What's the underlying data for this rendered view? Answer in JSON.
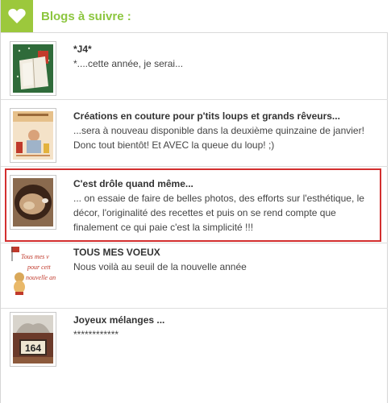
{
  "header": {
    "title": "Blogs à suivre :",
    "icon": "heart-icon",
    "accent": "#9cc83c"
  },
  "posts": [
    {
      "title": "*J4*",
      "excerpt": "*....cette année, je serai..."
    },
    {
      "title": "Créations en couture pour p'tits loups et grands rêveurs...",
      "excerpt": "...sera à nouveau disponible dans la deuxième quinzaine de janvier! Donc tout bientôt! Et AVEC la queue du loup! ;)"
    },
    {
      "title": "C'est drôle quand même...",
      "excerpt": "... on essaie de faire de belles photos, des efforts sur l'esthétique, le décor, l'originalité des recettes et puis on se rend compte que finalement ce qui paie c'est la simplicité !!!"
    },
    {
      "title": "TOUS MES VOEUX",
      "excerpt": "Nous voilà au seuil de la nouvelle année",
      "thumb_text": [
        "Tous mes v",
        "pour cett",
        "nouvelle an"
      ]
    },
    {
      "title": "Joyeux mélanges ...",
      "excerpt": "************",
      "thumb_text": "164"
    }
  ],
  "highlight_color": "#d32f2f"
}
